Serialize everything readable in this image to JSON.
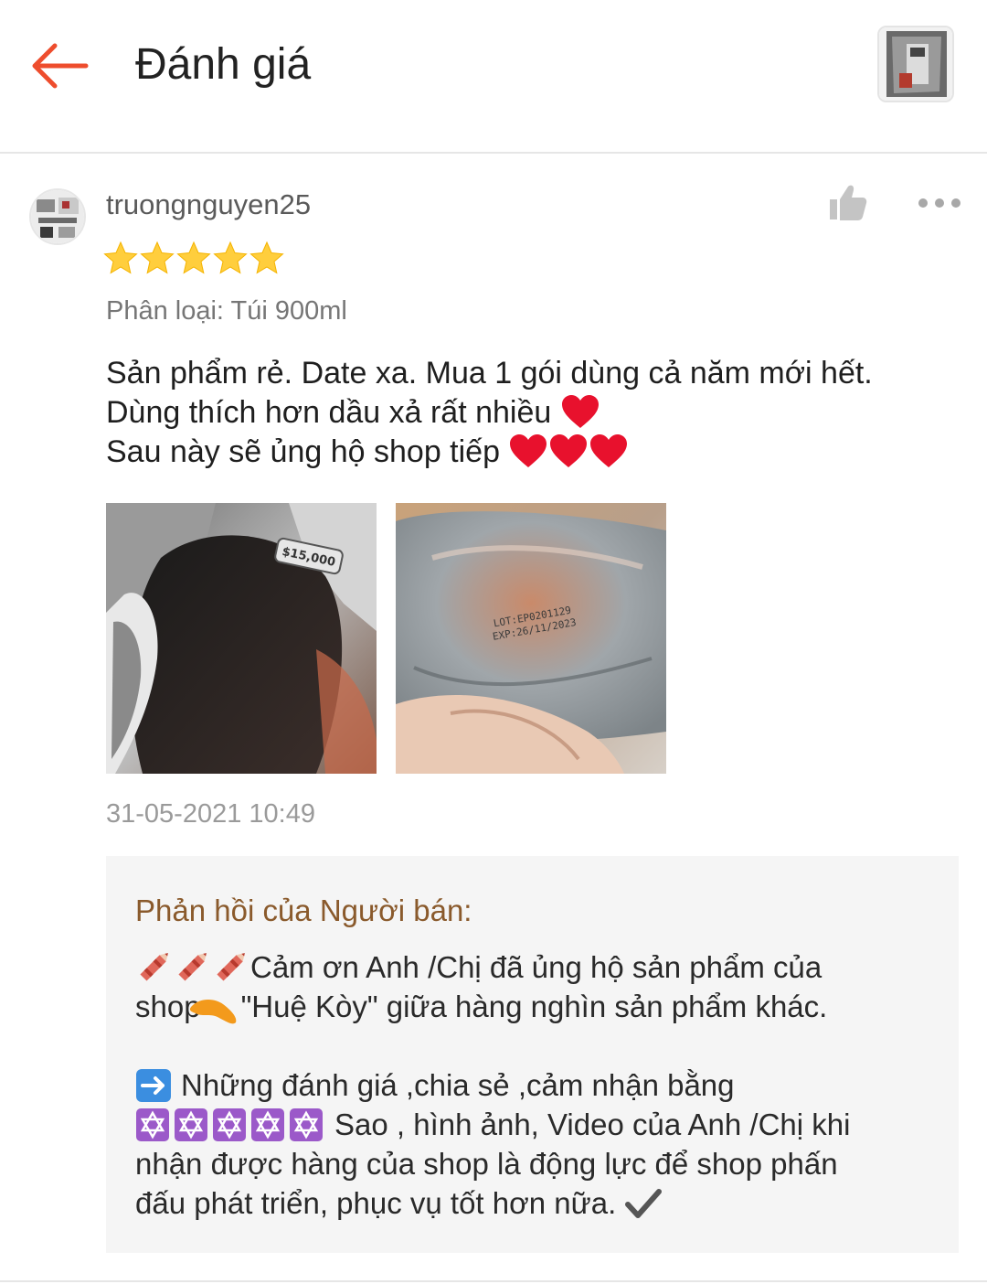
{
  "header": {
    "title": "Đánh giá"
  },
  "review": {
    "username": "truongnguyen25",
    "rating": 5,
    "variation": "Phân loại: Túi 900ml",
    "comment_lines": [
      "Sản phẩm rẻ. Date xa. Mua 1 gói dùng cả năm mới hết.",
      "Dùng thích hơn dầu xả rất nhiều",
      "Sau này sẽ ủng hộ shop tiếp"
    ],
    "photo1_price_tag": "$15,000",
    "photo2_print": [
      "LOT:EP0201129",
      "EXP:26/11/2023"
    ],
    "timestamp": "31-05-2021 10:49"
  },
  "seller_reply": {
    "title": "Phản hồi của Người bán:",
    "line1": "Cảm ơn Anh /Chị đã ủng hộ sản phẩm của",
    "line2a": "shop",
    "line2b": "\"Huệ Kòy\"  giữa hàng nghìn sản phẩm khác.",
    "line3": "Những đánh giá ,chia sẻ ,cảm nhận bằng",
    "line4": "Sao , hình ảnh, Video của Anh /Chị khi",
    "line5": "nhận được hàng của shop là động lực để shop phấn",
    "line6": "đấu phát triển, phục vụ tốt hơn nữa."
  },
  "icons": {
    "back": "back-arrow-icon",
    "like": "thumbs-up-icon",
    "more": "more-dots-icon",
    "star": "star-icon",
    "heart": "heart-icon"
  },
  "colors": {
    "accent": "#ee4d2d",
    "star": "#ffce3d",
    "seller_title": "#8a5a2c",
    "muted": "#9a9a9a"
  }
}
